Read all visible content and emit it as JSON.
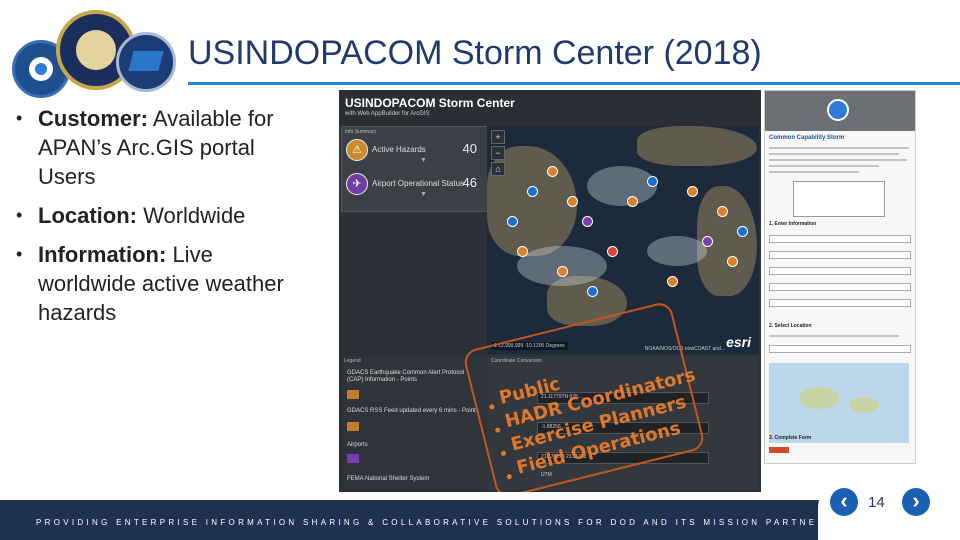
{
  "header": {
    "title": "USINDOPACOM Storm Center (2018)"
  },
  "bullets": [
    {
      "label": "Customer:",
      "text": " Available for APAN’s Arc.GIS portal Users"
    },
    {
      "label": "Location:",
      "text": " Worldwide"
    },
    {
      "label": "Information:",
      "text": " Live worldwide active weather hazards"
    }
  ],
  "app": {
    "title": "USINDOPACOM Storm Center",
    "subtitle": "with Web AppBuilder for ArcGIS",
    "info_summary": "Info Summary",
    "rows": [
      {
        "label": "Active Hazards",
        "value": "40"
      },
      {
        "label": "Airport Operational Status",
        "value": "46"
      }
    ],
    "legend_head": "Legend",
    "legend_items": [
      "GDACS Earthquake Common Alert Protocol (CAP) Information - Points",
      "GDACS RSS Feed updated every 6 mins - Points",
      "Airports",
      "FEMA National Shelter System"
    ],
    "coord_head": "Coordinate Conversion",
    "coord_values": [
      "21.11779TN 076...",
      "-1.88256 ...",
      "21.176299 23.11352"
    ],
    "coord_label": "UTM",
    "esri": "esri",
    "map_attrib": "NOAA/NOS/OCS nowCOAST and...",
    "map_scale": "1:12,999,999  -10.1200 Degrees"
  },
  "overlay": {
    "items": [
      "Public",
      "HADR Coordinators",
      "Exercise Planners",
      "Field Operations"
    ]
  },
  "thumb": {
    "title": "Common Capability Storm",
    "sections": [
      "1. Enter Information",
      "2. Select Location",
      "3. Complete Form"
    ]
  },
  "footer": {
    "text": "PROVIDING ENTERPRISE INFORMATION SHARING & COLLABORATIVE SOLUTIONS FOR DOD AND ITS MISSION PARTNERS",
    "page": "14",
    "prev_glyph": "‹",
    "next_glyph": "›"
  },
  "colors": {
    "title": "#1f3b6e",
    "rule": "#1e88d6",
    "footer": "#1f3350",
    "overlay": "#e0782c",
    "nav": "#1a5fb4"
  }
}
